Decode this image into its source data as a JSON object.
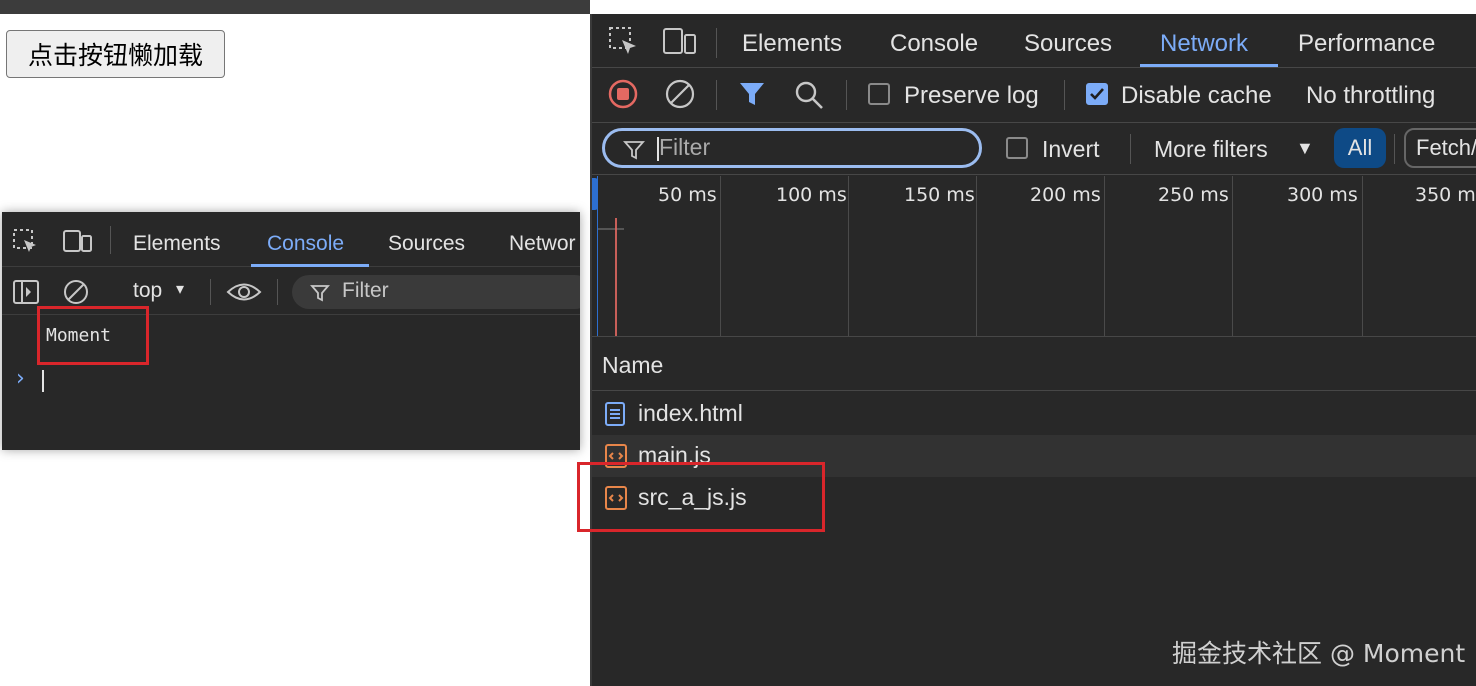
{
  "page": {
    "lazy_load_button": "点击按钮懒加载"
  },
  "console_devtools": {
    "tabs": [
      "Elements",
      "Console",
      "Sources",
      "Networ"
    ],
    "active_tab": "Console",
    "context": "top",
    "filter_placeholder": "Filter",
    "log_message": "Moment"
  },
  "network_devtools": {
    "tabs": [
      "Elements",
      "Console",
      "Sources",
      "Network",
      "Performance"
    ],
    "active_tab": "Network",
    "toolbar": {
      "preserve_log": "Preserve log",
      "disable_cache": "Disable cache",
      "disable_cache_checked": true,
      "preserve_log_checked": false,
      "throttling": "No throttling"
    },
    "filter_bar": {
      "filter_placeholder": "Filter",
      "invert": "Invert",
      "more_filters": "More filters",
      "all": "All",
      "fetch": "Fetch/"
    },
    "timeline_ticks": [
      "50 ms",
      "100 ms",
      "150 ms",
      "200 ms",
      "250 ms",
      "300 ms",
      "350 ms"
    ],
    "table": {
      "name_header": "Name",
      "rows": [
        {
          "name": "index.html",
          "type": "document"
        },
        {
          "name": "main.js",
          "type": "script"
        },
        {
          "name": "src_a_js.js",
          "type": "script"
        }
      ]
    }
  },
  "watermark": "掘金技术社区 @ Moment",
  "colors": {
    "accent": "#7cacf8",
    "highlight_box": "#d9262b",
    "panel_bg": "#282828",
    "record_red": "#e46962",
    "script_icon": "#e8864a",
    "doc_icon": "#7cacf8"
  }
}
